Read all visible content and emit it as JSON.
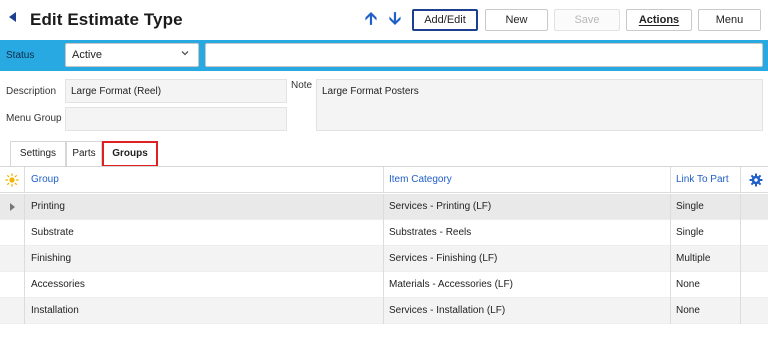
{
  "header": {
    "title": "Edit Estimate Type",
    "buttons": {
      "add_edit": "Add/Edit",
      "new": "New",
      "save": "Save",
      "actions": "Actions",
      "menu": "Menu"
    }
  },
  "status_bar": {
    "label": "Status",
    "value": "Active",
    "text_value": ""
  },
  "form": {
    "description_label": "Description",
    "description_value": "Large Format (Reel)",
    "menu_group_label": "Menu Group",
    "menu_group_value": "",
    "note_label": "Note",
    "note_value": "Large Format Posters"
  },
  "tabs": [
    {
      "label": "Settings"
    },
    {
      "label": "Parts"
    },
    {
      "label": "Groups",
      "active": true
    }
  ],
  "grid": {
    "columns": [
      "Group",
      "Item Category",
      "Link To Part"
    ],
    "rows": [
      {
        "group": "Printing",
        "item_category": "Services - Printing (LF)",
        "link_to_part": "Single"
      },
      {
        "group": "Substrate",
        "item_category": "Substrates - Reels",
        "link_to_part": "Single"
      },
      {
        "group": "Finishing",
        "item_category": "Services - Finishing (LF)",
        "link_to_part": "Multiple"
      },
      {
        "group": "Accessories",
        "item_category": "Materials - Accessories (LF)",
        "link_to_part": "None"
      },
      {
        "group": "Installation",
        "item_category": "Services - Installation (LF)",
        "link_to_part": "None"
      }
    ]
  },
  "icons": {
    "back": "back-arrow-icon",
    "move_up": "arrow-up-icon",
    "move_down": "arrow-down-icon",
    "status_dropdown": "chevron-down-icon",
    "header_sun": "sun-icon",
    "settings": "gear-icon",
    "expand": "expand-triangle-icon"
  },
  "colors": {
    "status_bar": "#29a9e1",
    "link_blue": "#1f5fc8",
    "active_tab_border": "#e02020",
    "selected_row": "#e9e9e9",
    "alt_row": "#f3f3f3"
  }
}
